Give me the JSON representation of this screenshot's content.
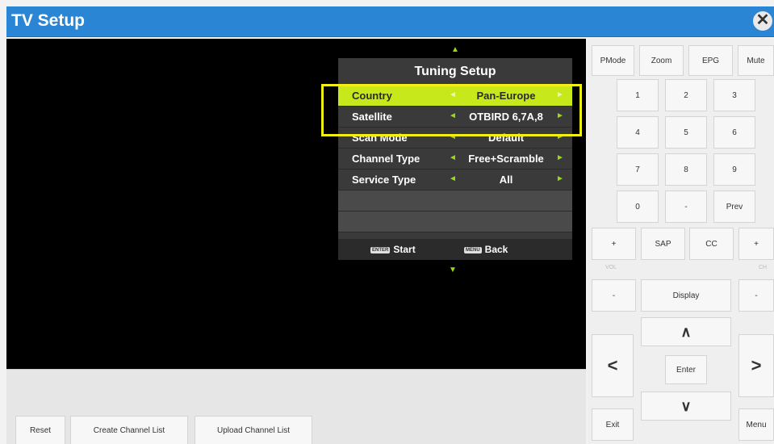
{
  "window": {
    "title": "TV Setup",
    "close_glyph": "✕",
    "close_icon": "close-icon"
  },
  "tv_menu": {
    "title": "Tuning Setup",
    "up_arrow": "▲",
    "down_arrow": "▼",
    "rows": [
      {
        "label": "Country",
        "value": "Pan-Europe",
        "left": "◄",
        "right": "►"
      },
      {
        "label": "Satellite",
        "value": "OTBIRD 6,7A,8",
        "left": "◄",
        "right": "►"
      },
      {
        "label": "Scan Mode",
        "value": "Default",
        "left": "◄",
        "right": "►"
      },
      {
        "label": "Channel Type",
        "value": "Free+Scramble",
        "left": "◄",
        "right": "►"
      },
      {
        "label": "Service Type",
        "value": "All",
        "left": "◄",
        "right": "►"
      }
    ],
    "footer": {
      "enter_key": "ENTER",
      "start": "Start",
      "menu_key": "MENU",
      "back": "Back"
    },
    "highlight_color": "#c7e81b",
    "callout_color": "#f3ef13"
  },
  "bottom_bar": {
    "reset": "Reset",
    "create": "Create Channel List",
    "upload": "Upload Channel List"
  },
  "remote": {
    "top": [
      "PMode",
      "Zoom",
      "EPG",
      "Mute"
    ],
    "digits": [
      "1",
      "2",
      "3",
      "4",
      "5",
      "6",
      "7",
      "8",
      "9",
      "0",
      "-",
      "Prev"
    ],
    "row_mid": {
      "vol_plus": "+",
      "sap": "SAP",
      "cc": "CC",
      "ch_plus": "+"
    },
    "vol": "VOL",
    "ch": "CH",
    "vol_minus": "-",
    "display": "Display",
    "ch_minus": "-",
    "up": "∧",
    "left": "<",
    "enter": "Enter",
    "right": ">",
    "down": "∨",
    "exit": "Exit",
    "menu": "Menu"
  },
  "colors": {
    "header": "#2a86d4",
    "screen": "#000000"
  }
}
